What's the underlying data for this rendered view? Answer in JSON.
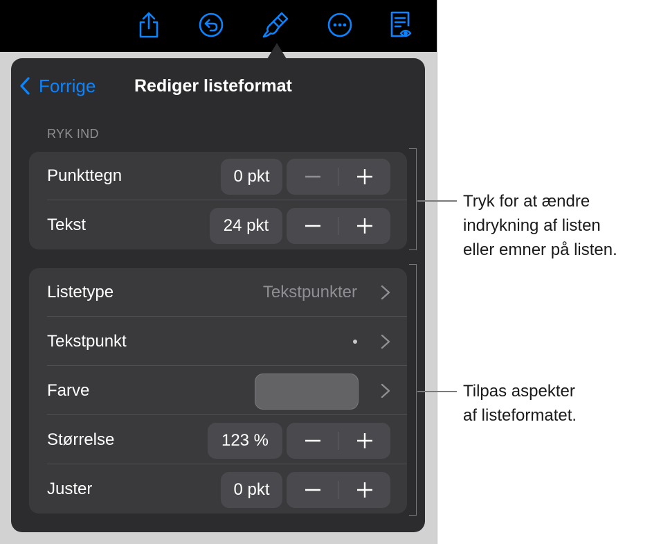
{
  "toolbar": {
    "icons": [
      "share-icon",
      "undo-icon",
      "format-brush-icon",
      "more-icon",
      "reader-view-icon"
    ],
    "accent": "#0a84ff"
  },
  "popover": {
    "back_label": "Forrige",
    "title": "Rediger listeformat",
    "indent_section": {
      "header": "RYK IND",
      "rows": [
        {
          "label": "Punkttegn",
          "value": "0 pkt"
        },
        {
          "label": "Tekst",
          "value": "24 pkt"
        }
      ]
    },
    "format_section": {
      "list_type": {
        "label": "Listetype",
        "value": "Tekstpunkter"
      },
      "bullet": {
        "label": "Tekstpunkt",
        "value": "•"
      },
      "color": {
        "label": "Farve",
        "swatch": "#636366"
      },
      "size": {
        "label": "Størrelse",
        "value": "123 %"
      },
      "align": {
        "label": "Juster",
        "value": "0 pkt"
      }
    },
    "stepper": {
      "minus_symbol": "−",
      "plus_symbol": "+"
    }
  },
  "callouts": {
    "indent": [
      "Tryk for at ændre",
      "indrykning af listen",
      "eller emner på listen."
    ],
    "format": [
      "Tilpas aspekter",
      "af listeformatet."
    ]
  }
}
